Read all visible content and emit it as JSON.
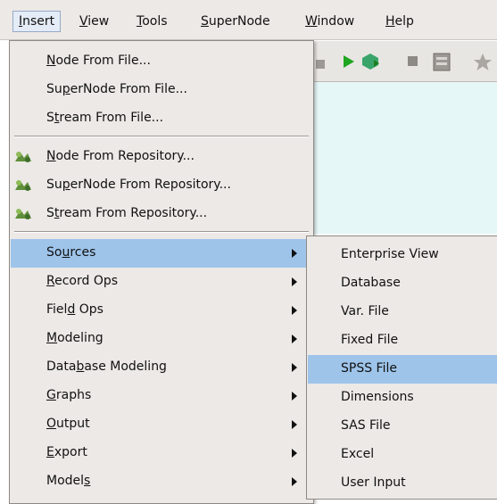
{
  "menubar": {
    "items": [
      {
        "pre": "",
        "u": "I",
        "post": "nsert"
      },
      {
        "pre": "",
        "u": "V",
        "post": "iew"
      },
      {
        "pre": "",
        "u": "T",
        "post": "ools"
      },
      {
        "pre": "",
        "u": "S",
        "post": "uperNode"
      },
      {
        "pre": "",
        "u": "W",
        "post": "indow"
      },
      {
        "pre": "",
        "u": "H",
        "post": "elp"
      }
    ]
  },
  "insert_menu": {
    "items": [
      {
        "pre": "",
        "u": "N",
        "post": "ode From File..."
      },
      {
        "pre": "Su",
        "u": "p",
        "post": "erNode From File..."
      },
      {
        "pre": "S",
        "u": "t",
        "post": "ream From File..."
      },
      {
        "pre": "",
        "u": "N",
        "post": "ode From Repository..."
      },
      {
        "pre": "Su",
        "u": "p",
        "post": "erNode From Repository..."
      },
      {
        "pre": "S",
        "u": "t",
        "post": "ream From Repository..."
      },
      {
        "pre": "So",
        "u": "u",
        "post": "rces"
      },
      {
        "pre": "",
        "u": "R",
        "post": "ecord Ops"
      },
      {
        "pre": "Fiel",
        "u": "d",
        "post": " Ops"
      },
      {
        "pre": "",
        "u": "M",
        "post": "odeling"
      },
      {
        "pre": "Data",
        "u": "b",
        "post": "ase Modeling"
      },
      {
        "pre": "",
        "u": "G",
        "post": "raphs"
      },
      {
        "pre": "",
        "u": "O",
        "post": "utput"
      },
      {
        "pre": "",
        "u": "E",
        "post": "xport"
      },
      {
        "pre": "Model",
        "u": "s",
        "post": ""
      }
    ]
  },
  "sources_menu": {
    "items": [
      "Enterprise View",
      "Database",
      "Var. File",
      "Fixed File",
      "SPSS File",
      "Dimensions",
      "SAS File",
      "Excel",
      "User Input"
    ]
  },
  "colors": {
    "menu_bg": "#ece9e6",
    "highlight": "#9ec4ea",
    "canvas": "#e6f7f7"
  },
  "icons": [
    "repository-icon",
    "run-icon",
    "stop-icon",
    "preview-icon",
    "star-icon"
  ]
}
